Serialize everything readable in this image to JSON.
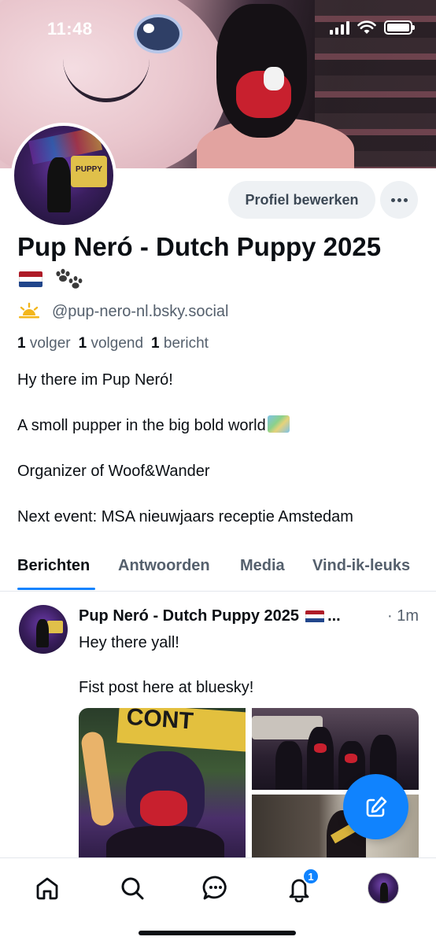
{
  "status_bar": {
    "time": "11:48"
  },
  "profile": {
    "edit_button": "Profiel bewerken",
    "display_name": "Pup Neró - Dutch Puppy 2025",
    "name_emojis": [
      "nl-flag",
      "paw-prints"
    ],
    "handle": "@pup-nero-nl.bsky.social",
    "avatar_sign_text": "PUPPY",
    "counts": {
      "followers_num": "1",
      "followers_label": "volger",
      "following_num": "1",
      "following_label": "volgend",
      "posts_num": "1",
      "posts_label": "bericht"
    },
    "bio": [
      "Hy there im Pup Neró!",
      "A smoll pupper in the big bold world",
      "Organizer of Woof&Wander",
      "Next event: MSA nieuwjaars receptie Amstedam"
    ]
  },
  "tabs": [
    {
      "label": "Berichten",
      "active": true
    },
    {
      "label": "Antwoorden",
      "active": false
    },
    {
      "label": "Media",
      "active": false
    },
    {
      "label": "Vind-ik-leuks",
      "active": false
    }
  ],
  "post": {
    "author": "Pup Neró - Dutch Puppy 2025",
    "ellipsis": "...",
    "time": "· 1m",
    "lines": [
      "Hey there yall!",
      "Fist post here at bluesky!"
    ],
    "image_banner_text": "CONT"
  },
  "bottom_nav": {
    "items": [
      "home-icon",
      "search-icon",
      "chat-icon",
      "bell-icon",
      "profile-avatar"
    ],
    "notification_badge": "1"
  },
  "colors": {
    "accent": "#1083fe",
    "text_primary": "#0b0f14",
    "text_secondary": "#55606d",
    "button_bg": "#eef1f4"
  }
}
